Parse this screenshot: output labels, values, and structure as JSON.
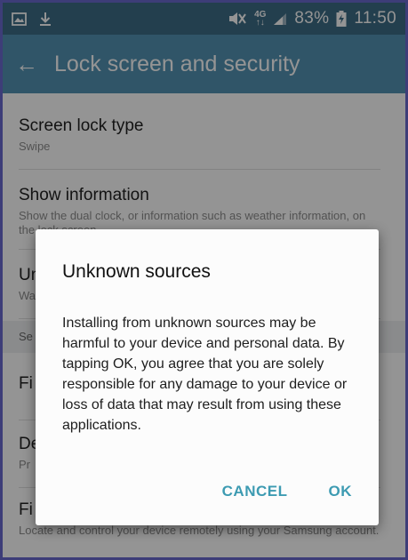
{
  "status_bar": {
    "network_label": "4G",
    "battery": "83%",
    "time": "11:50"
  },
  "app_bar": {
    "title": "Lock screen and security"
  },
  "settings": {
    "items": [
      {
        "title": "Screen lock type",
        "subtitle": "Swipe"
      },
      {
        "title": "Show information",
        "subtitle": "Show the dual clock, or information such as weather information, on the lock screen."
      },
      {
        "title": "Un",
        "subtitle": "Wa"
      },
      {
        "title": "Fi",
        "subtitle": ""
      },
      {
        "title": "De",
        "subtitle": "Pr"
      },
      {
        "title": "Fi",
        "subtitle": "Locate and control your device remotely using your Samsung account."
      }
    ],
    "section_header": "Se"
  },
  "dialog": {
    "title": "Unknown sources",
    "message": "Installing from unknown sources may be harmful to your device and personal data. By tapping OK, you agree that you are solely responsible for any damage to your device or loss of data that may result from using these applications.",
    "cancel_label": "CANCEL",
    "ok_label": "OK"
  }
}
